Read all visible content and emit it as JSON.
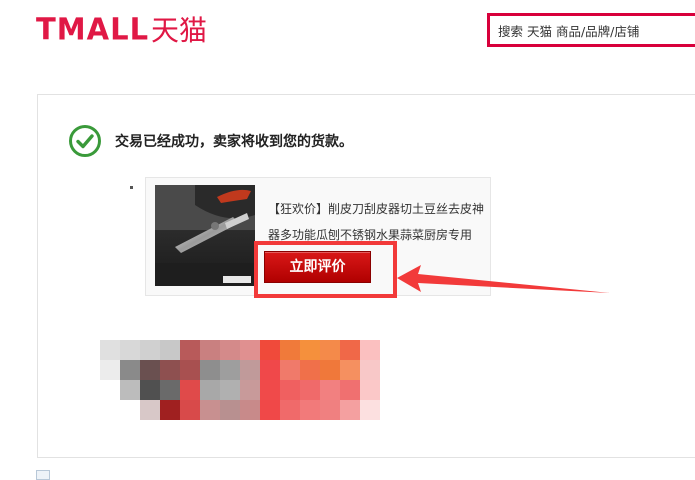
{
  "header": {
    "logo_latin": "TMALL",
    "logo_cn": "天猫",
    "search_placeholder": "搜索 天猫 商品/品牌/店铺"
  },
  "status": {
    "message": "交易已经成功，卖家将收到您的货款。"
  },
  "product": {
    "title": "【狂欢价】削皮刀刮皮器切土豆丝去皮神器多功能瓜刨不锈钢水果蒜菜厨房专用"
  },
  "actions": {
    "review_label": "立即评价"
  },
  "colors": {
    "brand": "#e01845",
    "button": "#c40000",
    "annotation": "#f23a3a",
    "success": "#3a9a3a"
  }
}
